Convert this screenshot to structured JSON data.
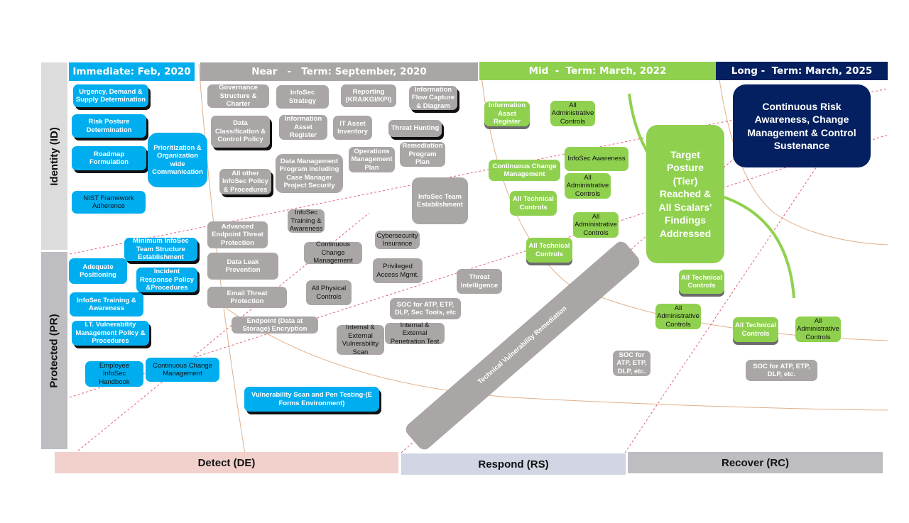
{
  "headers": {
    "immediate": "Immediate: Feb, 2020",
    "near": "Near   -   Term: September, 2020",
    "mid": "Mid  -  Term: March, 2022",
    "long": "Long -  Term: March, 2025"
  },
  "rows": {
    "identity": "Identity (ID)",
    "protected": "Protected (PR)"
  },
  "footer": {
    "detect": "Detect (DE)",
    "respond": "Respond (RS)",
    "recover": "Recover (RC)"
  },
  "colors": {
    "immediate": "#00aeef",
    "near": "#a9a6a5",
    "mid": "#8fd14f",
    "long": "#052060",
    "detect": "#f2d0cb",
    "respond": "#d1d5e4",
    "recover": "#bebdc1"
  },
  "immediate_items": [
    "Urgency, Demand &\nSupply Determination",
    "Risk  Posture\nDetermination",
    "Roadmap\nFormulation",
    "NIST Framework\nAdherence",
    "Prioritization &\nOrganization\nwide\nCommunication",
    "Minimum  InfoSec\nTeam Structure\nEstablishment",
    "Adequate\nPositioning",
    "Incident\nResponse Policy\n&Procedures",
    "InfoSec Training &\nAwareness",
    "I.T. Vulnerability\nManagement Policy &\nProcedures",
    "Employee InfoSec\nHandbook",
    "Continuous Change\nManagement",
    "Vulnerability Scan and Pen Testing-(E\nForms Environment)"
  ],
  "near_items": [
    "Governance\nStructure &\nCharter",
    "InfoSec\nStrategy",
    "Reporting\n(KRA/KGI/KPI)",
    "Information\nFlow  Capture\n& Diagram",
    "Data\nClassification &\nControl Policy",
    "Information\nAsset\nRegister",
    "IT Asset\nInventory",
    "Threat Hunting",
    "Remediation\nProgram\nPlan",
    "Operations\nManagement\nPlan",
    "Data Management\nProgram including\nCase Manager\nProject Security",
    "All other\nInfoSec Policy\n& Procedures",
    "InfoSec Team\nEstablishment",
    "InfoSec\nTraining &\nAwareness",
    "Advanced\nEndpoint Threat\nProtection",
    "Continuous\nChange\nManagement",
    "Cybersecurity\nInsurance",
    "Data Leak\nPrevention",
    "Privileged\nAccess Mgmt.",
    "Threat\nIntelligence",
    "Email Threat Protection",
    "All Physical\nControls",
    "SOC for ATP, ETP,\nDLP, Sec Tools, etc",
    "Endpoint  (Data at\nStorage) Encryption",
    "Internal &\nExternal\nVulnerability\nScan",
    "Internal & External\nPenetration Test",
    "Technical Vulnerability Remediation"
  ],
  "mid_items": [
    "Information\nAsset\nRegister",
    "All\nAdministrative\nControls",
    "InfoSec Awareness",
    "Continuous Change\nManagement",
    "All\nAdministrative\nControls",
    "All Technical\nControls",
    "All\nAdministrative\nControls",
    "All Technical\nControls",
    "Target\nPosture\n(Tier)\nReached &\nAll Scalars'\nFindings\nAddressed",
    "All Technical\nControls",
    "All\nAdministrative\nControls",
    "SOC for\nATP, ETP,\nDLP, etc."
  ],
  "long_items": [
    "Continuous Risk\nAwareness, Change\nManagement & Control\nSustenance",
    "All Technical\nControls",
    "All\nAdministrative\nControls",
    "SOC for ATP, ETP,\nDLP, etc."
  ]
}
